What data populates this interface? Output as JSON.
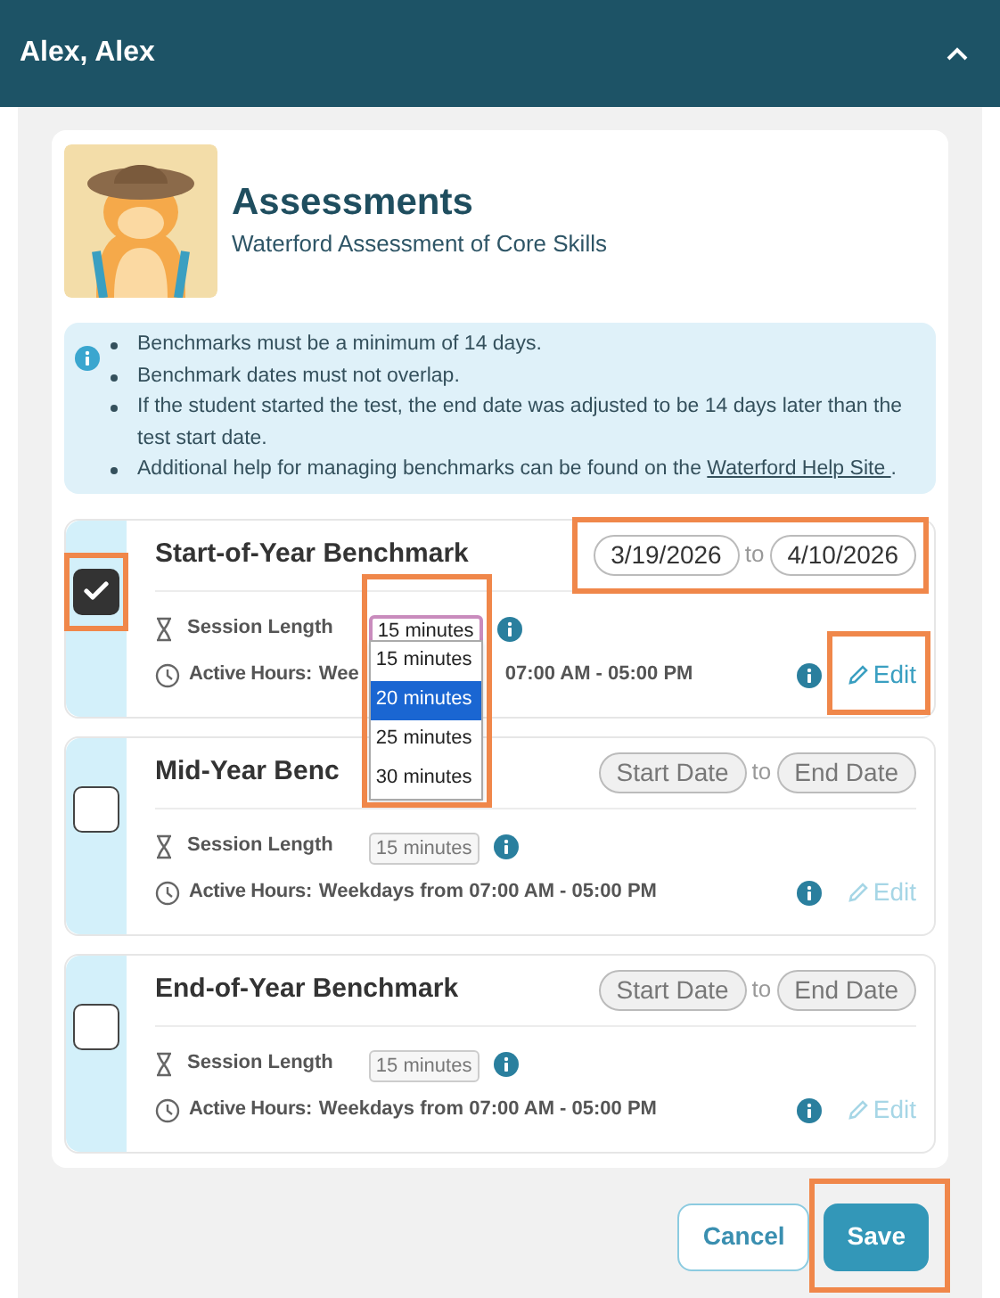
{
  "header": {
    "title": "Alex, Alex",
    "expanded": true
  },
  "assessment": {
    "title": "Assessments",
    "subtitle": "Waterford Assessment of Core Skills"
  },
  "notes": [
    {
      "kind": "text",
      "text": "Benchmarks must be a minimum of 14 days."
    },
    {
      "kind": "text",
      "text": "Benchmark dates must not overlap."
    },
    {
      "kind": "text",
      "text": "If the student started the test, the end date was adjusted to be 14 days later than the test start date."
    },
    {
      "kind": "link",
      "text": "Additional help for managing benchmarks can be found on the ",
      "link": "Waterford Help Site ",
      "after": "."
    }
  ],
  "benchmarks": [
    {
      "title": "Start-of-Year Benchmark",
      "checked": true,
      "start_date": {
        "value": "3/19/2026"
      },
      "to": "to",
      "end_date": {
        "value": "4/10/2026"
      },
      "session_label": "Session Length",
      "session_length": "15 minutes",
      "session_focused": true,
      "dropdown": [
        {
          "label": "15 minutes",
          "selected": false
        },
        {
          "label": "20 minutes",
          "selected": true
        },
        {
          "label": "25 minutes",
          "selected": false
        },
        {
          "label": "30 minutes",
          "selected": false
        }
      ],
      "hours_label": "Active Hours:",
      "hours": [
        "Wee",
        "07:00 AM - 05:00 PM"
      ],
      "edit": "Edit",
      "edit_disabled": false,
      "highlight": {
        "checkbox": true,
        "dates": true,
        "session": true,
        "edit": true
      }
    },
    {
      "title": "Mid-Year Benc",
      "checked": false,
      "start_date": {
        "placeholder": "Start Date"
      },
      "to": "to",
      "end_date": {
        "placeholder": "End Date"
      },
      "session_label": "Session Length",
      "session_length": "15 minutes",
      "session_focused": false,
      "hours_label": "Active Hours:",
      "hours": [
        "Weekdays from 07:00 AM - 05:00 PM"
      ],
      "edit": "Edit",
      "edit_disabled": true
    },
    {
      "title": "End-of-Year Benchmark",
      "checked": false,
      "start_date": {
        "placeholder": "Start Date"
      },
      "to": "to",
      "end_date": {
        "placeholder": "End Date"
      },
      "session_label": "Session Length",
      "session_length": "15 minutes",
      "session_focused": false,
      "hours_label": "Active Hours:",
      "hours": [
        "Weekdays from 07:00 AM - 05:00 PM"
      ],
      "edit": "Edit",
      "edit_disabled": true
    }
  ],
  "buttons": [
    {
      "kind": "secondary",
      "label": "Cancel",
      "highlighted": false
    },
    {
      "kind": "primary",
      "label": "Save",
      "highlighted": true
    }
  ]
}
